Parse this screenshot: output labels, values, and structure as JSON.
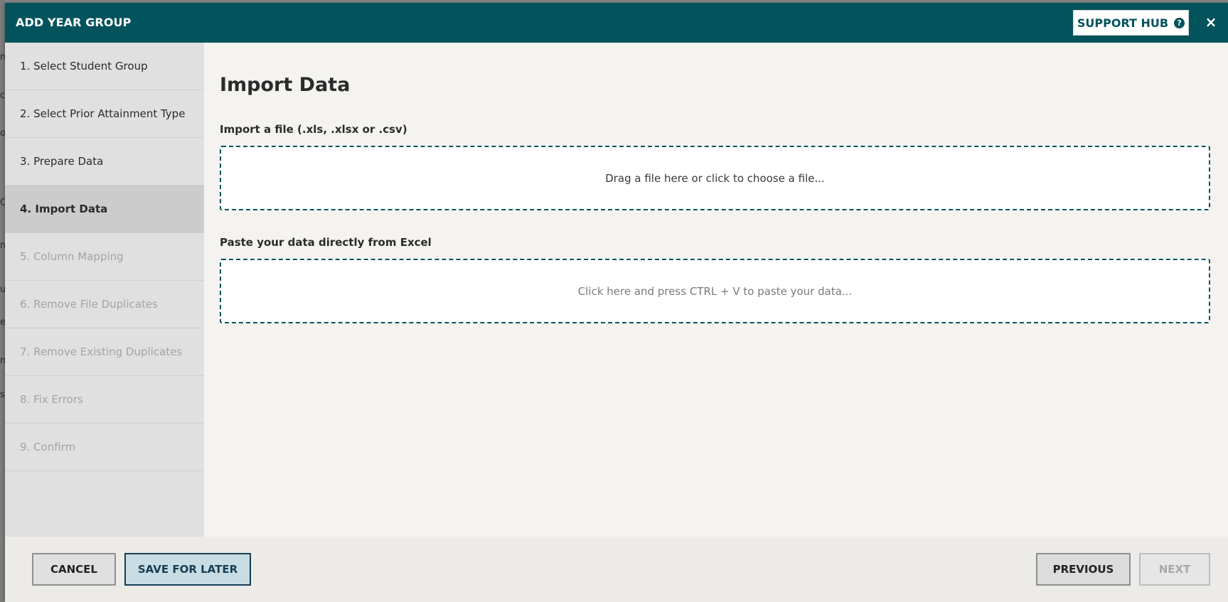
{
  "header": {
    "title": "ADD YEAR GROUP",
    "support_label": "SUPPORT HUB",
    "help_glyph": "?",
    "close_glyph": "×"
  },
  "backdrop_fragments": [
    "n",
    "c",
    "o",
    "C",
    "n",
    "u",
    "e",
    "n",
    "st"
  ],
  "steps": [
    {
      "label": "1. Select Student Group",
      "state": "completed"
    },
    {
      "label": "2. Select Prior Attainment Type",
      "state": "completed"
    },
    {
      "label": "3. Prepare Data",
      "state": "completed"
    },
    {
      "label": "4. Import Data",
      "state": "active"
    },
    {
      "label": "5. Column Mapping",
      "state": "disabled"
    },
    {
      "label": "6. Remove File Duplicates",
      "state": "disabled"
    },
    {
      "label": "7. Remove Existing Duplicates",
      "state": "disabled"
    },
    {
      "label": "8. Fix Errors",
      "state": "disabled"
    },
    {
      "label": "9. Confirm",
      "state": "disabled"
    }
  ],
  "main": {
    "title": "Import Data",
    "file_section_label": "Import a file (.xls, .xlsx or .csv)",
    "file_dropzone_text": "Drag a file here or click to choose a file...",
    "paste_section_label": "Paste your data directly from Excel",
    "paste_zone_text": "Click here and press CTRL + V to paste your data..."
  },
  "footer": {
    "cancel_label": "CANCEL",
    "save_label": "SAVE FOR LATER",
    "previous_label": "PREVIOUS",
    "next_label": "NEXT"
  },
  "colors": {
    "header_bg": "#02535c",
    "accent_border": "#02535c",
    "active_step_bg": "#cccccc",
    "save_button_bg": "#c8dce3"
  },
  "icons": {
    "help": "help-circle-icon",
    "close": "close-icon"
  }
}
